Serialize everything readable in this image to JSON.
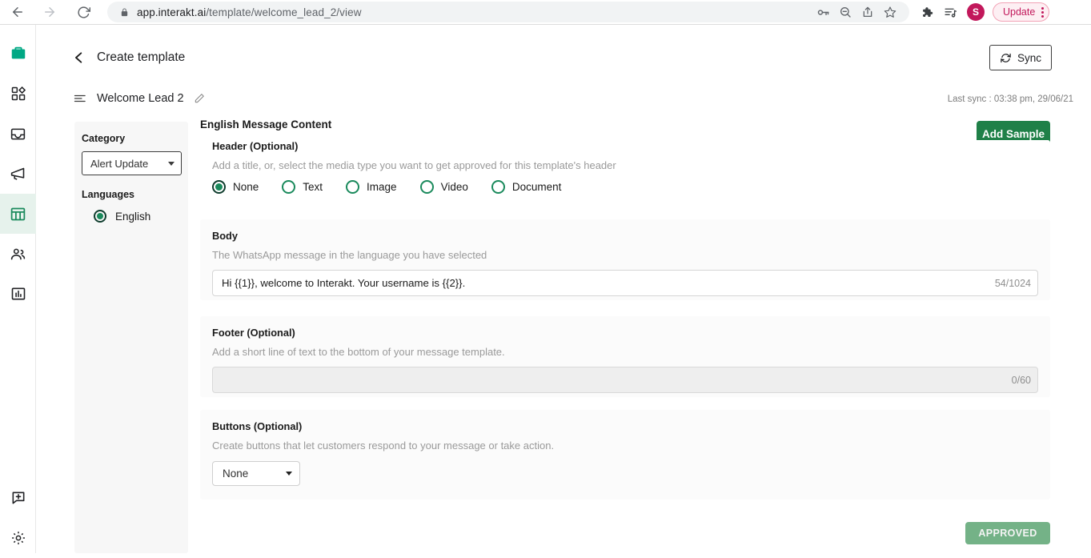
{
  "browser": {
    "url_host": "app.interakt.ai",
    "url_path": "/template/welcome_lead_2/view",
    "back_icon": "back-arrow-icon",
    "forward_icon": "forward-arrow-icon",
    "reload_icon": "reload-icon",
    "lock_icon": "lock-icon",
    "password_icon": "key-icon",
    "zoom_icon": "zoom-out-icon",
    "share_icon": "share-icon",
    "bookmark_icon": "star-icon",
    "extensions_icon": "puzzle-icon",
    "playlist_icon": "media-list-icon",
    "avatar_initial": "S",
    "update_label": "Update",
    "menu_icon": "kebab-menu-icon",
    "avatar_color": "#c2185b",
    "update_color": "#c2185b"
  },
  "sidebar": {
    "items": [
      {
        "icon": "briefcase-brand-icon",
        "name": "brand-logo",
        "active": false
      },
      {
        "icon": "dashboard-grid-icon",
        "name": "sidebar-item-dashboard",
        "active": false
      },
      {
        "icon": "inbox-icon",
        "name": "sidebar-item-inbox",
        "active": false
      },
      {
        "icon": "megaphone-icon",
        "name": "sidebar-item-campaigns",
        "active": false
      },
      {
        "icon": "template-table-icon",
        "name": "sidebar-item-templates",
        "active": true
      },
      {
        "icon": "contacts-people-icon",
        "name": "sidebar-item-contacts",
        "active": false
      },
      {
        "icon": "analytics-bar-chart-icon",
        "name": "sidebar-item-analytics",
        "active": false
      }
    ],
    "bottom_items": [
      {
        "icon": "add-chat-icon",
        "name": "sidebar-item-new-chat"
      },
      {
        "icon": "gear-icon",
        "name": "sidebar-item-settings"
      }
    ],
    "active_color": "#1a8a5c",
    "active_bg": "#e6f2ec"
  },
  "header": {
    "back_icon": "chevron-left-icon",
    "title": "Create template",
    "sync_label": "Sync",
    "sync_icon": "refresh-icon",
    "last_sync": "Last sync : 03:38 pm, 29/06/21"
  },
  "template": {
    "list_icon": "sort-lines-icon",
    "name": "Welcome Lead 2",
    "edit_icon": "pencil-icon"
  },
  "left_panel": {
    "category_label": "Category",
    "category_value": "Alert Update",
    "category_caret": "chevron-down-icon",
    "languages_label": "Languages",
    "languages": [
      {
        "label": "English",
        "selected": true
      }
    ]
  },
  "main": {
    "content_title": "English Message Content",
    "add_sample_label": "Add Sample",
    "add_sample_color": "#1f8048",
    "header_section": {
      "title": "Header (Optional)",
      "description": "Add a title, or, select the media type you want to get approved for this template's header",
      "options": [
        {
          "label": "None",
          "selected": true
        },
        {
          "label": "Text",
          "selected": false
        },
        {
          "label": "Image",
          "selected": false
        },
        {
          "label": "Video",
          "selected": false
        },
        {
          "label": "Document",
          "selected": false
        }
      ]
    },
    "body_section": {
      "title": "Body",
      "description": "The WhatsApp message in the language you have selected",
      "value": "Hi {{1}}, welcome to Interakt. Your username is {{2}}.",
      "counter": "54/1024"
    },
    "footer_section": {
      "title": "Footer (Optional)",
      "description": "Add a short line of text to the bottom of your message template.",
      "value": "",
      "counter": "0/60"
    },
    "buttons_section": {
      "title": "Buttons (Optional)",
      "description": "Create buttons that let customers respond to your message or take action.",
      "selected": "None",
      "caret": "chevron-down-icon"
    },
    "status_label": "APPROVED",
    "status_color": "#74b287"
  }
}
